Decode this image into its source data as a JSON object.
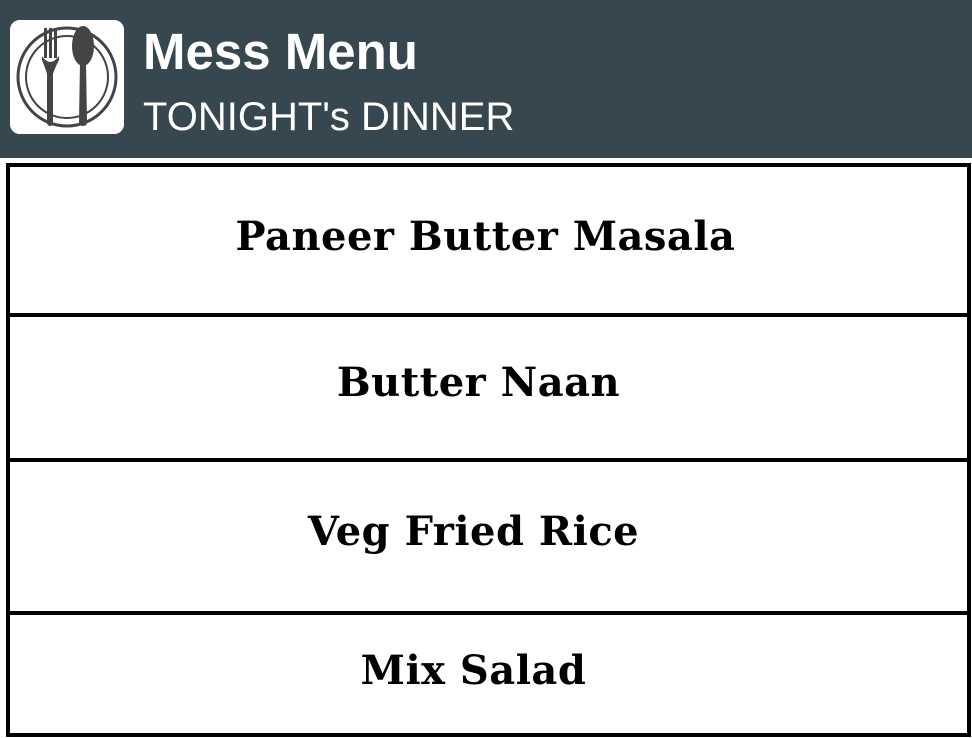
{
  "header": {
    "title": "Mess Menu",
    "subtitle": "TONIGHT's DINNER",
    "icon": "plate-fork-spoon-icon",
    "background_color": "#37474f",
    "text_color": "#ffffff"
  },
  "menu": {
    "items": [
      {
        "label": "Paneer Butter Masala"
      },
      {
        "label": "Butter Naan"
      },
      {
        "label": "Veg Fried Rice"
      },
      {
        "label": "Mix Salad"
      }
    ]
  }
}
